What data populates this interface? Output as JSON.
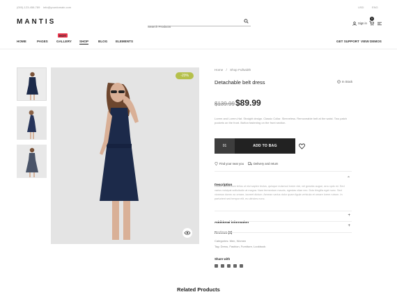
{
  "topbar": {
    "phone": "(000)-123-456-789",
    "email": "info@yourdomain.com",
    "currency": "USD",
    "language": "ENG"
  },
  "header": {
    "logo": "MANTIS",
    "search_placeholder": "Search Products",
    "sign_in": "Sign in",
    "cart_count": "0"
  },
  "nav": {
    "items": [
      "HOME",
      "PAGES",
      "GALLERY",
      "SHOP",
      "BLOG",
      "ELEMENTS"
    ],
    "hot_badge": "HOT",
    "active": "SHOP",
    "right": [
      "GET SUPPORT",
      "VIEW DEMOS"
    ]
  },
  "product": {
    "discount_badge": "-20%",
    "breadcrumb": [
      "Home",
      "Shop Fullwidth"
    ],
    "title": "Detachable belt dress",
    "stock": "In Stock",
    "old_price": "$139.99",
    "price": "$89.99",
    "short_desc": "Lorem and Lorem-Hat. Straight design. Classic Collar. Sleeveless. Removeable belt at the waist. Two patch pockets on the front. Button fastening on the front section.",
    "quantity": "01",
    "add_to_bag": "ADD TO BAG",
    "find_store": "Find your near you",
    "delivery": "Delivery and return",
    "description_title": "Description",
    "description_body": "Donec elementum tellus ut nisl sapien lectus, quisque euismod lorem nisl, vel gravida augue, arcu quis mi. Sed varius volutpat sollicitudin at magna. Nam fermentum mauris, egestas vitae nec. Duis fringilla eget nunc. Sed vivamus donec ac ornare, laoreet dictum. Aenean varius dolor quam ligula vehicula et ornare lorem rutrum. In parturient sed tempor elit, eu ultricies nunc.",
    "additional_title": "Additional information",
    "reviews_title": "Reviews (0)",
    "categories": "Categories: Men, Women",
    "tags": "Tag: Dress, Fashion, Furniture, Lookbook",
    "share_title": "Share with"
  },
  "related_title": "Related Products"
}
